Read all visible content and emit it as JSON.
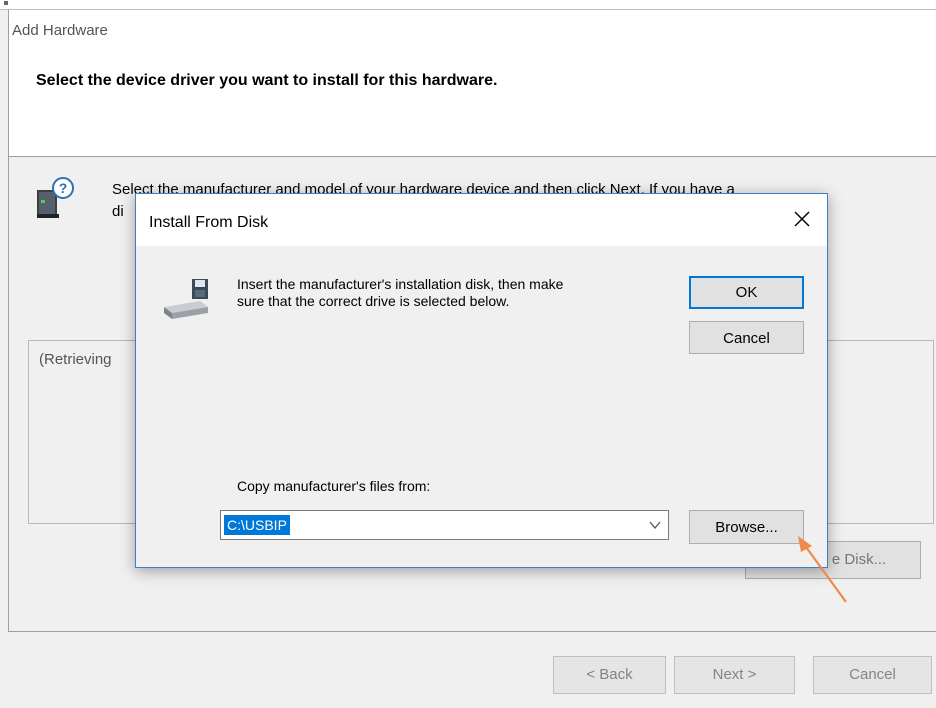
{
  "wizard": {
    "title": "Add Hardware",
    "heading": "Select the device driver you want to install for this hardware.",
    "instruction_line1": "Select the manufacturer and model of your hardware device and then click Next. If you have a",
    "instruction_line2": "di",
    "list_placeholder": "(Retrieving",
    "have_disk_label": "e Disk...",
    "back_label": "< Back",
    "next_label": "Next >",
    "cancel_label": "Cancel"
  },
  "dialog": {
    "title": "Install From Disk",
    "message": "Insert the manufacturer's installation disk, then make sure that the correct drive is selected below.",
    "ok_label": "OK",
    "cancel_label": "Cancel",
    "copy_label": "Copy manufacturer's files from:",
    "path_value": "C:\\USBIP",
    "browse_label": "Browse..."
  },
  "icons": {
    "hardware": "hardware-help-icon",
    "disk": "disk-drive-icon",
    "close": "close-icon",
    "dropdown": "chevron-down-icon"
  },
  "colors": {
    "accent": "#0078d7",
    "annotation_arrow": "#f08a4b"
  }
}
